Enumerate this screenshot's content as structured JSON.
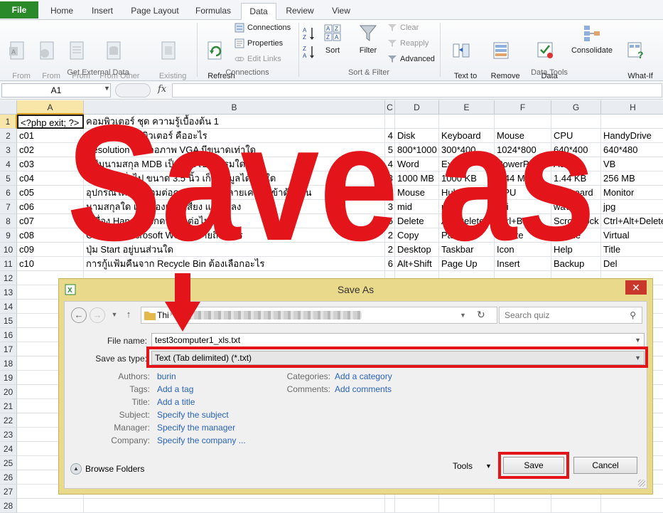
{
  "ribbon": {
    "tabs": [
      "File",
      "Home",
      "Insert",
      "Page Layout",
      "Formulas",
      "Data",
      "Review",
      "View"
    ],
    "active_tab": "Data",
    "get_external": {
      "from_access": "From\nAccess",
      "from_web": "From\nWeb",
      "from_text": "From\nText",
      "from_other": "From Other\nSources ▾",
      "existing": "Existing\nConnections",
      "group_label": "Get External Data"
    },
    "connections": {
      "refresh": "Refresh\nAll ▾",
      "connections": "Connections",
      "properties": "Properties",
      "edit_links": "Edit Links",
      "group_label": "Connections"
    },
    "sort_filter": {
      "sort": "Sort",
      "filter": "Filter",
      "clear": "Clear",
      "reapply": "Reapply",
      "advanced": "Advanced",
      "group_label": "Sort & Filter"
    },
    "data_tools": {
      "text_to_columns": "Text to\nColumns",
      "remove_duplicates": "Remove\nDuplicates",
      "data_validation": "Data\nValidation ▾",
      "consolidate": "Consolidate",
      "what_if": "What-If\nAnalysis ▾",
      "group_label": "Data Tools"
    }
  },
  "formula_bar": {
    "name_box": "A1",
    "fx": "fx"
  },
  "columns": [
    "A",
    "B",
    "C",
    "D",
    "E",
    "F",
    "G",
    "H"
  ],
  "rows": [
    [
      "<?php exit; ?>",
      "คอมพิวเตอร์ ชุด ความรู้เบื้องต้น 1",
      "",
      "",
      "",
      "",
      "",
      ""
    ],
    [
      "c01",
      "สมองของคอมพิวเตอร์ คืออะไร",
      "4",
      "Disk",
      "Keyboard",
      "Mouse",
      "CPU",
      "HandyDrive"
    ],
    [
      "c02",
      "Resolution ของจอภาพ VGA มีขนาดเท่าใด",
      "5",
      "800*1000",
      "300*400",
      "1024*800",
      "640*400",
      "640*480"
    ],
    [
      "c03",
      "แฟ้มนามสกุล MDB เป็นของโปรแกรมใด",
      "4",
      "Word",
      "Excel",
      "PowerPoint",
      "Access",
      "VB"
    ],
    [
      "c04",
      "Diskette ทั่วไป ขนาด 3.5 นิ้ว เก็บข้อมูลได้เท่าใด",
      "3",
      "1000 MB",
      "1000 KB",
      "1.44 MB",
      "1.44 KB",
      "256 MB"
    ],
    [
      "c05",
      "อุปกรณ์ใด ใช้เชื่อมต่อคอมพิวเตอร์หลายเครื่องเข้าด้วยกัน",
      "2",
      "Mouse",
      "Hub",
      "CPU",
      "Keyboard",
      "Monitor"
    ],
    [
      "c06",
      "นามสกุลใด เป็นของแฟ้มเสียง และเพลง",
      "3",
      "mid",
      "mp3",
      "avi",
      "wav",
      "jpg"
    ],
    [
      "c07",
      "เครื่อง Hang ต้องกดปุ่มใดต่อไปนี้",
      "5",
      "Delete",
      "Alt+Delete",
      "Ctrl+Break",
      "Scroll Lock",
      "Ctrl+Alt+Delete"
    ],
    [
      "c08",
      "Ctrl+V ในMicrosoft Word หมายถึงอะไร",
      "2",
      "Copy",
      "Paste",
      "Delete",
      "Visible",
      "Virtual"
    ],
    [
      "c09",
      "ปุ่ม Start อยู่บนส่วนใด",
      "2",
      "Desktop",
      "Taskbar",
      "Icon",
      "Help",
      "Title"
    ],
    [
      "c10",
      "การกู้แฟ้มคืนจาก Recycle Bin ต้องเลือกอะไร",
      "6",
      "Alt+Shift",
      "Page Up",
      "Insert",
      "Backup",
      "Del"
    ]
  ],
  "row_numbers": [
    "1",
    "2",
    "3",
    "4",
    "5",
    "6",
    "7",
    "8",
    "9",
    "10",
    "11",
    "12",
    "13",
    "14",
    "15",
    "16",
    "17",
    "18",
    "19",
    "20",
    "21",
    "22",
    "23",
    "24",
    "25",
    "26",
    "27",
    "28"
  ],
  "overlay": {
    "text": "Save as",
    "color": "#e3151b"
  },
  "dialog": {
    "title": "Save As",
    "close": "✕",
    "path_start": "Thi",
    "search_placeholder": "Search quiz",
    "file_name_label": "File name:",
    "file_name": "test3computer1_xls.txt",
    "save_type_label": "Save as type:",
    "save_type": "Text (Tab delimited) (*.txt)",
    "authors_label": "Authors:",
    "authors": "burin",
    "tags_label": "Tags:",
    "tags": "Add a tag",
    "title_label": "Title:",
    "title_value": "Add a title",
    "subject_label": "Subject:",
    "subject": "Specify the subject",
    "manager_label": "Manager:",
    "manager": "Specify the manager",
    "company_label": "Company:",
    "company": "Specify the company ...",
    "categories_label": "Categories:",
    "categories": "Add a category",
    "comments_label": "Comments:",
    "comments": "Add comments",
    "browse_folders": "Browse Folders",
    "tools": "Tools",
    "save": "Save",
    "cancel": "Cancel"
  },
  "colors": {
    "accent_red": "#e3151b",
    "file_tab": "#2a8a2a",
    "link_blue": "#2a62b8",
    "dialog_frame": "#e9d98a"
  }
}
